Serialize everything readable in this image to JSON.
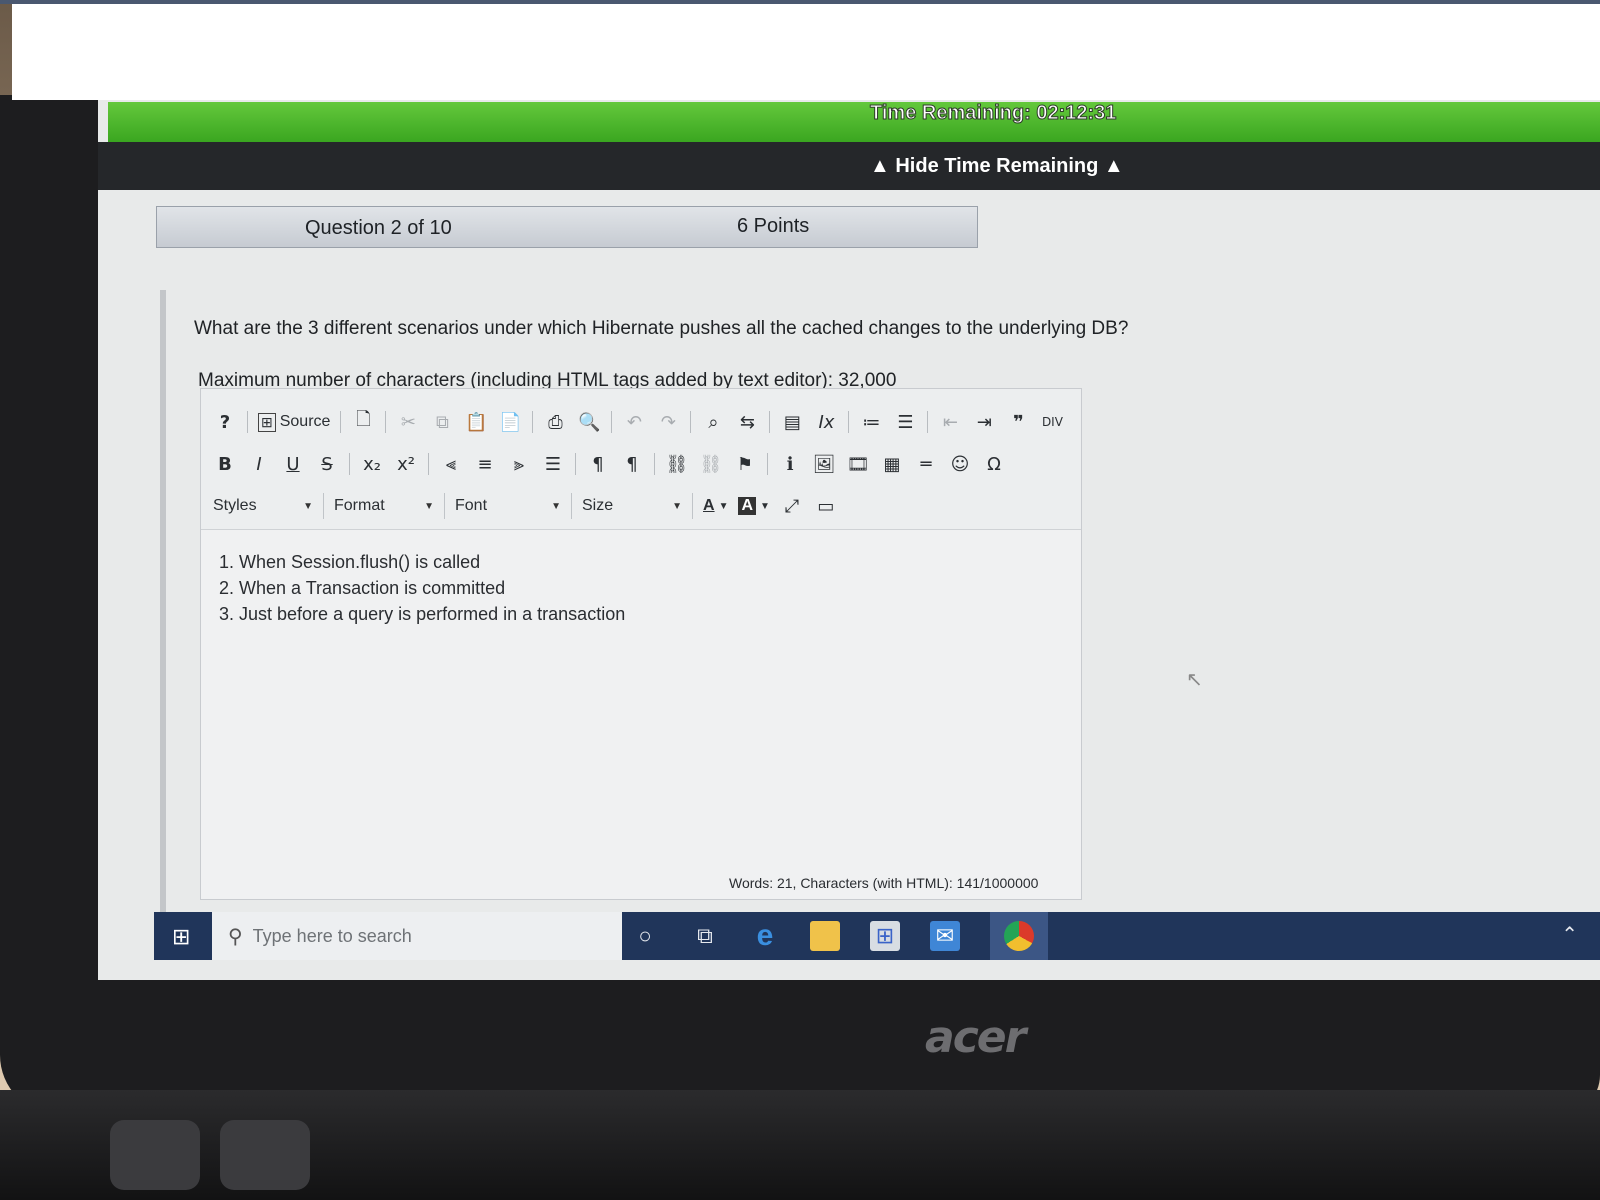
{
  "timer": {
    "text": "Time Remaining: 02:12:31",
    "hide_label": "▲ Hide Time Remaining ▲"
  },
  "question_header": {
    "number": "Question 2 of 10",
    "points": "6 Points"
  },
  "question": {
    "text": "What are the 3 different scenarios under which Hibernate pushes all the cached changes to the underlying DB?"
  },
  "editor": {
    "max_chars": "Maximum number of characters (including HTML tags added by text editor): 32,000",
    "toolbar": {
      "help": "?",
      "source": "Source",
      "bold": "B",
      "italic": "I",
      "underline": "U",
      "strike": "S",
      "subscript": "x₂",
      "superscript": "x²",
      "omega": "Ω",
      "styles": "Styles",
      "format": "Format",
      "font": "Font",
      "size": "Size",
      "text_color": "A",
      "bg_color": "A"
    },
    "content_lines": [
      "1. When Session.flush() is called",
      "2. When a Transaction is committed",
      "3. Just before a query is performed in a transaction"
    ],
    "status": "Words: 21, Characters (with HTML): 141/1000000"
  },
  "taskbar": {
    "search_placeholder": "Type here to search"
  },
  "device": {
    "brand": "acer"
  }
}
